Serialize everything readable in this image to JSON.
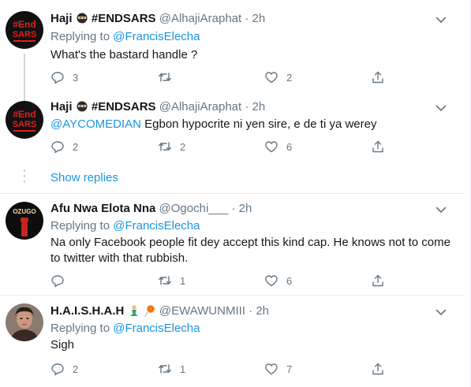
{
  "tweets": [
    {
      "name": "Haji",
      "tag": "#ENDSARS",
      "handle": "@AlhajiAraphat",
      "dot": "·",
      "time": "2h",
      "replying_prefix": "Replying to ",
      "replying_to": "@FrancisElecha",
      "text": "What's the bastard handle ?",
      "replies": "3",
      "retweets": "",
      "likes": "2",
      "avatar_text_1": "#End",
      "avatar_text_2": "SARS"
    },
    {
      "name": "Haji",
      "tag": "#ENDSARS",
      "handle": "@AlhajiAraphat",
      "dot": "·",
      "time": "2h",
      "mention": "@AYCOMEDIAN",
      "text": " Egbon hypocrite ni yen sire, e de ti ya werey",
      "replies": "2",
      "retweets": "2",
      "likes": "6",
      "avatar_text_1": "#End",
      "avatar_text_2": "SARS"
    },
    {
      "name": "Afu Nwa Elota Nna",
      "handle": "@Ogochi___",
      "dot": "·",
      "time": "2h",
      "replying_prefix": "Replying to ",
      "replying_to": "@FrancisElecha",
      "text_line_1": "Na only Facebook people fit dey accept this kind cap. He knows not to come",
      "text_line_2": "to twitter with that rubbish.",
      "replies": "",
      "retweets": "1",
      "likes": "6",
      "avatar_text_1": "OZUGO"
    },
    {
      "name": "H.A.I.S.H.A.H",
      "handle": "@EWAWUNMIII",
      "dot": "·",
      "time": "2h",
      "replying_prefix": "Replying to ",
      "replying_to": "@FrancisElecha",
      "text": "Sigh",
      "replies": "2",
      "retweets": "1",
      "likes": "7"
    }
  ],
  "show_replies": "Show replies",
  "icons": {
    "reply": "reply-icon",
    "retweet": "retweet-icon",
    "like": "heart-icon",
    "share": "share-icon",
    "more": "chevron-down-icon"
  },
  "colors": {
    "link": "#1b95e0",
    "secondary_text": "#657786",
    "divider": "#e6ecf0",
    "endsars_red": "#e0201b"
  }
}
